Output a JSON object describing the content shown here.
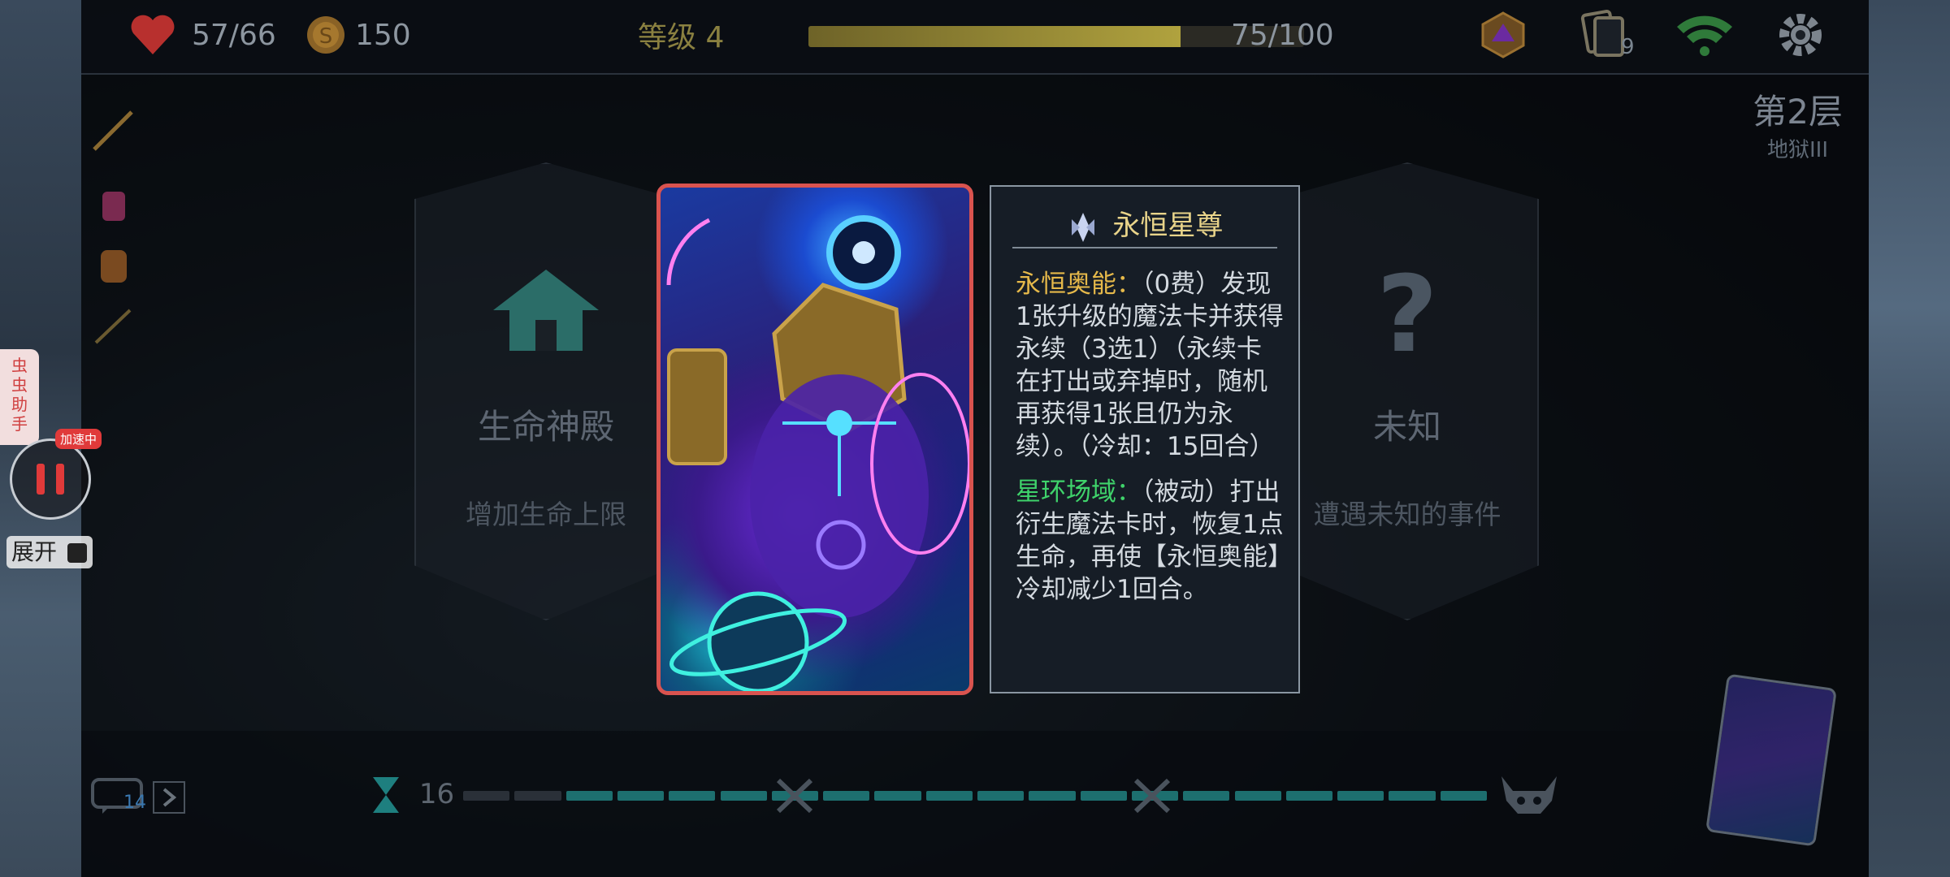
{
  "hud": {
    "hp": "57/66",
    "gold": "150",
    "level_label": "等级 4",
    "xp_progress": 0.75,
    "xp_text": "75/100",
    "deck_count": "9",
    "colors": {
      "hp": "#d03a3a",
      "gold": "#a6782e",
      "xp_fill": "#b0a23e",
      "wifi": "#2f9a45"
    }
  },
  "floor": {
    "title": "第2层",
    "subtitle": "地狱III"
  },
  "choices": [
    {
      "title": "生命神殿",
      "desc": "增加生命上限",
      "icon": "temple-icon"
    },
    {
      "title": "未知",
      "desc": "遭遇未知的事件",
      "icon": "question-icon"
    }
  ],
  "tooltip": {
    "name": "永恒星尊",
    "ability1_name": "永恒奥能：",
    "ability1_cost": "（0费）",
    "ability1_text": "发现1张升级的魔法卡并获得永续（3选1）（永续卡在打出或弃掉时，随机再获得1张且仍为永续）。（冷却：15回合）",
    "ability2_name": "星环场域：",
    "ability2_type": "（被动）",
    "ability2_text": "打出衍生魔法卡时，恢复1点生命，再使【永恒奥能】冷却减少1回合。"
  },
  "helper": {
    "name": "虫虫助手",
    "badge": "加速中",
    "expand_label": "展开"
  },
  "bottom": {
    "chat_count": "14",
    "turn_count": "16",
    "progress_segments_filled": 18,
    "progress_segments_total": 20
  }
}
